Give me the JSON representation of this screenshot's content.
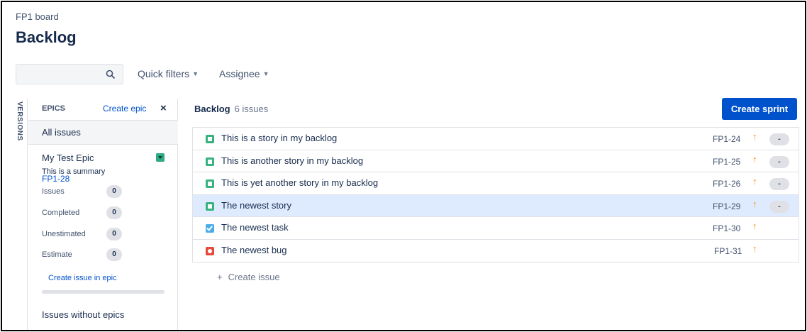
{
  "header": {
    "breadcrumb": "FP1 board",
    "title": "Backlog"
  },
  "toolbar": {
    "search_placeholder": "",
    "quick_filters_label": "Quick filters",
    "assignee_label": "Assignee"
  },
  "sidebar": {
    "versions_label": "VERSIONS",
    "epics_label": "EPICS",
    "create_epic_label": "Create epic",
    "close_label": "×",
    "all_issues_label": "All issues",
    "epic": {
      "name": "My Test Epic",
      "key": "FP1-28",
      "summary": "This is a summary",
      "color": "#2eaa85",
      "stats": [
        {
          "label": "Issues",
          "value": "0"
        },
        {
          "label": "Completed",
          "value": "0"
        },
        {
          "label": "Unestimated",
          "value": "0"
        },
        {
          "label": "Estimate",
          "value": "0"
        }
      ],
      "create_issue_label": "Create issue in epic",
      "progress_fraction": 0
    },
    "issues_without_epics_label": "Issues without epics"
  },
  "backlog": {
    "title": "Backlog",
    "count_label": "6 issues",
    "create_sprint_label": "Create sprint",
    "issues": [
      {
        "type": "story",
        "summary": "This is a story in my backlog",
        "key": "FP1-24",
        "priority": "↑",
        "estimate": "-",
        "selected": false
      },
      {
        "type": "story",
        "summary": "This is another story in my backlog",
        "key": "FP1-25",
        "priority": "↑",
        "estimate": "-",
        "selected": false
      },
      {
        "type": "story",
        "summary": "This is yet another story in my backlog",
        "key": "FP1-26",
        "priority": "↑",
        "estimate": "-",
        "selected": false
      },
      {
        "type": "story",
        "summary": "The newest story",
        "key": "FP1-29",
        "priority": "↑",
        "estimate": "-",
        "selected": true
      },
      {
        "type": "task",
        "summary": "The newest task",
        "key": "FP1-30",
        "priority": "↑",
        "estimate": null,
        "selected": false
      },
      {
        "type": "bug",
        "summary": "The newest bug",
        "key": "FP1-31",
        "priority": "↑",
        "estimate": null,
        "selected": false
      }
    ],
    "create_issue_label": "Create issue",
    "create_issue_plus": "+"
  },
  "colors": {
    "accent": "#0052cc",
    "selected_row": "#deebff",
    "priority": "#ff8b00",
    "story": "#36b37e",
    "task": "#4bade8",
    "bug": "#e5493a"
  }
}
